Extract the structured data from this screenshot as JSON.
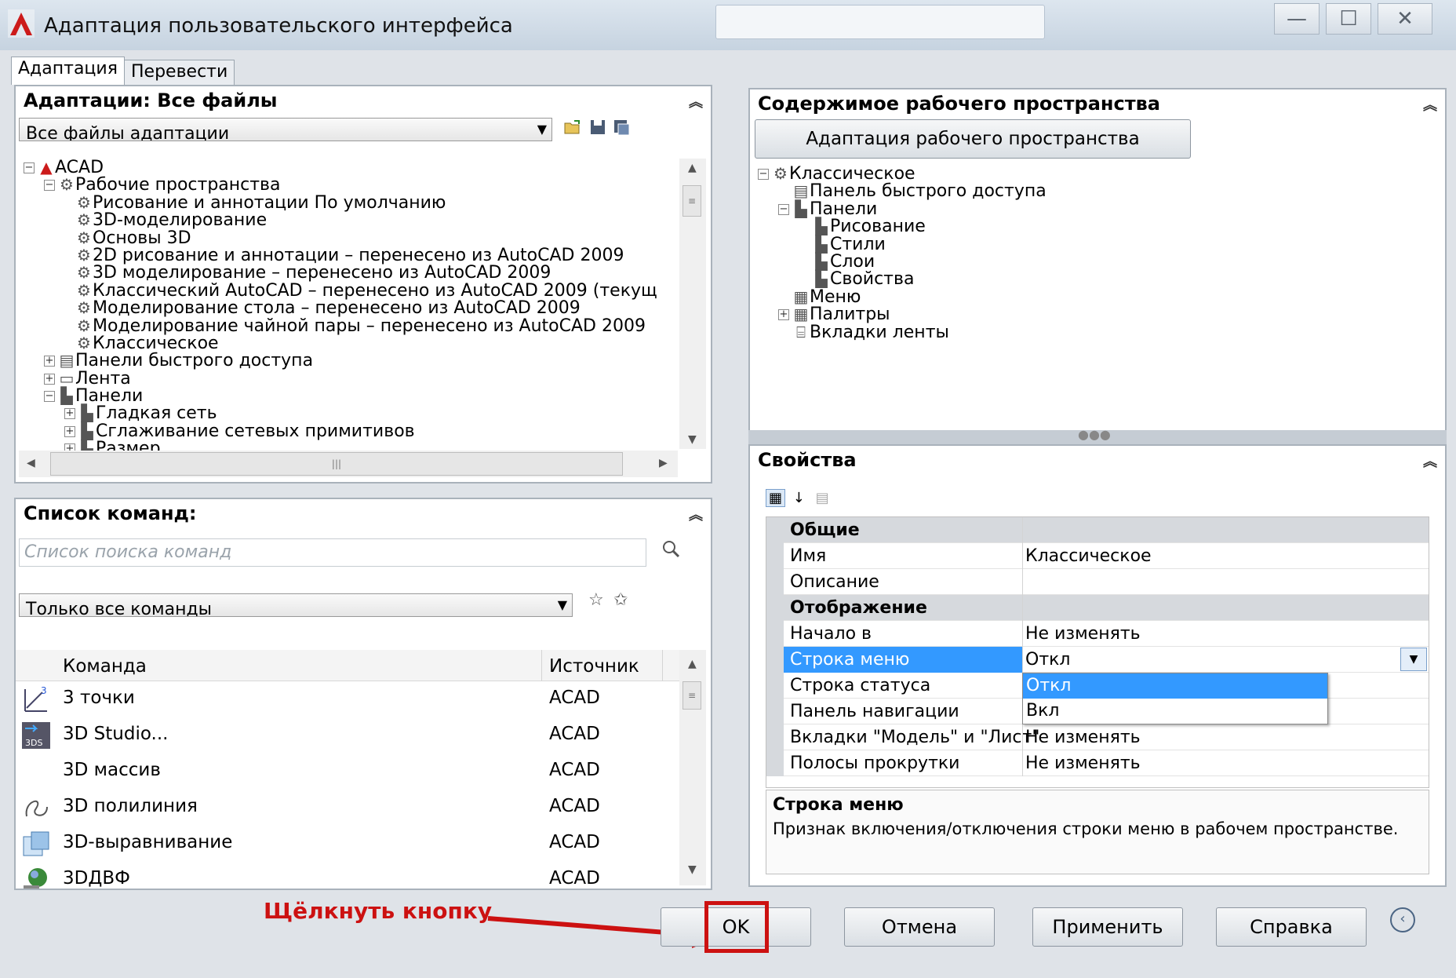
{
  "window": {
    "title": "Адаптация пользовательского интерфейса",
    "buttons": [
      "—",
      "☐",
      "✕"
    ]
  },
  "tabs": [
    "Адаптация",
    "Перевести"
  ],
  "left_panel": {
    "title": "Адаптации: Все файлы",
    "file_select": "Все файлы адаптации",
    "tree": [
      "ACAD",
      "Рабочие пространства",
      "Рисование и аннотации По умолчанию",
      "3D-моделирование",
      "Основы 3D",
      "2D рисование и аннотации – перенесено из AutoCAD 2009",
      "3D моделирование – перенесено из AutoCAD 2009",
      "Классический AutoCAD – перенесено из AutoCAD 2009 (текущ",
      "Моделирование стола – перенесено из AutoCAD 2009",
      "Моделирование чайной пары – перенесено из AutoCAD 2009",
      "Классическое",
      "Панели быстрого доступа",
      "Лента",
      "Панели",
      "Гладкая сеть",
      "Сглаживание сетевых примитивов",
      "Размер"
    ]
  },
  "commands": {
    "title": "Список команд:",
    "search_placeholder": "Список поиска команд",
    "filter": "Только все команды",
    "col_command": "Команда",
    "col_source": "Источник",
    "rows": [
      {
        "name": "3 точки",
        "source": "ACAD",
        "icon": "3-points-icon"
      },
      {
        "name": "3D Studio...",
        "source": "ACAD",
        "icon": "3ds-icon"
      },
      {
        "name": "3D массив",
        "source": "ACAD",
        "icon": ""
      },
      {
        "name": "3D полилиния",
        "source": "ACAD",
        "icon": "3d-polyline-icon"
      },
      {
        "name": "3D-выравнивание",
        "source": "ACAD",
        "icon": "3d-align-icon"
      },
      {
        "name": "3DДВФ",
        "source": "ACAD",
        "icon": "3d-dwf-icon"
      }
    ]
  },
  "workspace": {
    "title": "Содержимое рабочего пространства",
    "button": "Адаптация рабочего пространства",
    "tree": [
      "Классическое",
      "Панель быстрого доступа",
      "Панели",
      "Рисование",
      "Стили",
      "Слои",
      "Свойства",
      "Меню",
      "Палитры",
      "Вкладки ленты"
    ]
  },
  "properties": {
    "title": "Свойства",
    "section_general": "Общие",
    "name_label": "Имя",
    "name_value": "Классическое",
    "desc_label": "Описание",
    "desc_value": "",
    "section_display": "Отображение",
    "start_label": "Начало в",
    "start_value": "Не изменять",
    "menubar_label": "Строка меню",
    "menubar_value": "Откл",
    "status_label": "Строка статуса",
    "nav_label": "Панель навигации",
    "tabs_label": "Вкладки \"Модель\" и \"Лист\"",
    "tabs_value": "Не изменять",
    "scroll_label": "Полосы прокрутки",
    "scroll_value": "Не изменять",
    "dropdown_options": [
      "Откл",
      "Вкл"
    ],
    "desc_title": "Строка меню",
    "desc_text": "Признак включения/отключения строки меню в рабочем пространстве."
  },
  "annotation": "Щёлкнуть кнопку",
  "buttons": {
    "ok": "OK",
    "cancel": "Отмена",
    "apply": "Применить",
    "help": "Справка"
  },
  "colors": {
    "selection": "#3399ff",
    "annotation": "#cc1111"
  }
}
